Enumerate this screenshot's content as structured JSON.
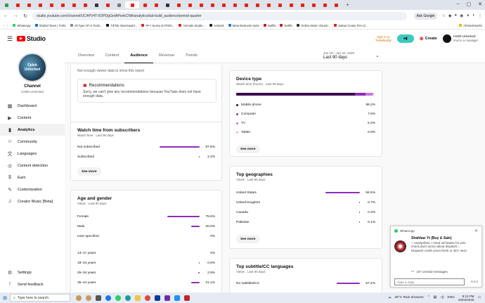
{
  "browser": {
    "url": "studio.youtube.com/channel/UC4PV4T-0OPDgGeIAPonkCNA/analytics/tab-build_audience/period-quarter",
    "ask_google": "Ask Google",
    "bookmarks": [
      "WhatsApp",
      "Shahid Team | Trello",
      "All Type Of AI Tools...",
      "TikTok downloader...",
      "PF-I Sunny EATING...",
      "Animals Studio...",
      "Animals",
      "Meta Business Suite",
      "Netflix",
      "Netflix",
      "Online Music Visuali...",
      "Salaar Cease Fire (2..."
    ],
    "all_bookmarks": "All Bookmarks"
  },
  "header": {
    "logo_text": "Studio",
    "tubebuddy": "Sign in to\nTubeBuddy",
    "create_label": "Create",
    "user_name": "Celeb Unlocked",
    "user_sub": "You're a manager"
  },
  "sidebar": {
    "avatar_text": "Celeb\nUnlocked",
    "channel_label": "Channel",
    "channel_name": "Celeb Unlocked",
    "items": [
      {
        "label": "Dashboard",
        "icon": "dashboard-icon"
      },
      {
        "label": "Content",
        "icon": "content-icon"
      },
      {
        "label": "Analytics",
        "icon": "analytics-icon"
      },
      {
        "label": "Community",
        "icon": "community-icon"
      },
      {
        "label": "Languages",
        "icon": "languages-icon"
      },
      {
        "label": "Content detection",
        "icon": "content-detection-icon"
      },
      {
        "label": "Earn",
        "icon": "earn-icon"
      },
      {
        "label": "Customization",
        "icon": "customization-icon"
      },
      {
        "label": "Creator Music [Beta]",
        "icon": "creator-music-icon"
      }
    ],
    "settings_label": "Settings",
    "feedback_label": "Send feedback"
  },
  "tabs": [
    "Overview",
    "Content",
    "Audience",
    "Revenue",
    "Trends"
  ],
  "date_range": {
    "range": "Jan 23 – Apr 22, 2026",
    "label": "Last 90 days"
  },
  "recommend": {
    "top_note": "Not enough viewer data to show this report",
    "title": "Recommendations",
    "body": "Sorry, we can't give any recommendations because YouTube does not have enough data."
  },
  "subscribers": {
    "title": "Watch time from subscribers",
    "subtitle": "Watch time · Last 90 days",
    "rows": [
      {
        "label": "Not subscribed",
        "pct": "97.8%",
        "value": 97.8
      },
      {
        "label": "Subscribed",
        "pct": "2.2%",
        "value": 2.2
      }
    ],
    "see_more": "See more"
  },
  "age_gender": {
    "title": "Age and gender",
    "subtitle": "Views · Last 90 days",
    "rows": [
      {
        "label": "Female",
        "pct": "79.6%",
        "value": 79.6
      },
      {
        "label": "Male",
        "pct": "20.0%",
        "value": 20.0
      },
      {
        "label": "User-specified",
        "pct": "0%",
        "value": 0
      },
      {
        "label": "13–17 years",
        "pct": "0%",
        "value": 0
      },
      {
        "label": "18–24 years",
        "pct": "0.6%",
        "value": 0.6
      },
      {
        "label": "25–34 years",
        "pct": "2.8%",
        "value": 2.8
      },
      {
        "label": "35–44 years",
        "pct": "21.1%",
        "value": 21.1
      }
    ]
  },
  "device": {
    "title": "Device type",
    "subtitle": "Watch time (hours) · Last 90 days",
    "rows": [
      {
        "label": "Mobile phone",
        "pct": "86.2%",
        "value": 86.2,
        "color": "#3b0a4f"
      },
      {
        "label": "Computer",
        "pct": "7.6%",
        "value": 7.6,
        "color": "#8d2db8"
      },
      {
        "label": "TV",
        "pct": "5.2%",
        "value": 5.2,
        "color": "#c277e0"
      },
      {
        "label": "Tablet",
        "pct": "0.9%",
        "value": 0.9,
        "color": "#e2b6f2"
      }
    ],
    "see_more": "See more"
  },
  "geographies": {
    "title": "Top geographies",
    "subtitle": "Views · Last 90 days",
    "rows": [
      {
        "label": "United States",
        "pct": "84.5%",
        "value": 84.5
      },
      {
        "label": "United Kingdom",
        "pct": "0.7%",
        "value": 0.7
      },
      {
        "label": "Canada",
        "pct": "0.3%",
        "value": 0.3
      },
      {
        "label": "Pakistan",
        "pct": "0.1%",
        "value": 0.1
      }
    ],
    "see_more": "See more"
  },
  "subtitles": {
    "title": "Top subtitle/CC languages",
    "subtitle": "Views · Last 90 days",
    "rows": [
      {
        "label": "No subtitles/CC",
        "pct": "57.4%",
        "value": 57.4
      }
    ]
  },
  "whatsapp": {
    "app": "WhatsApp",
    "sender": "Shahbaz Yt (Buy & Sale)",
    "message": "~ candyvibes: I need old banks for wire check,don't worry about dispatch...",
    "message2": "Dispatch credit union fresh or old I neec",
    "unread": "107 unread messages",
    "reply_placeholder": "Type a reply",
    "send": "Send"
  },
  "taskbar": {
    "search": "Type here to search",
    "weather": "29°C  Rain showers",
    "lang": "ENG",
    "time": "9:13 PM",
    "date": "23/04/2026"
  },
  "colors": {
    "accent": "#8d2db8",
    "brand": "#ff0000"
  }
}
